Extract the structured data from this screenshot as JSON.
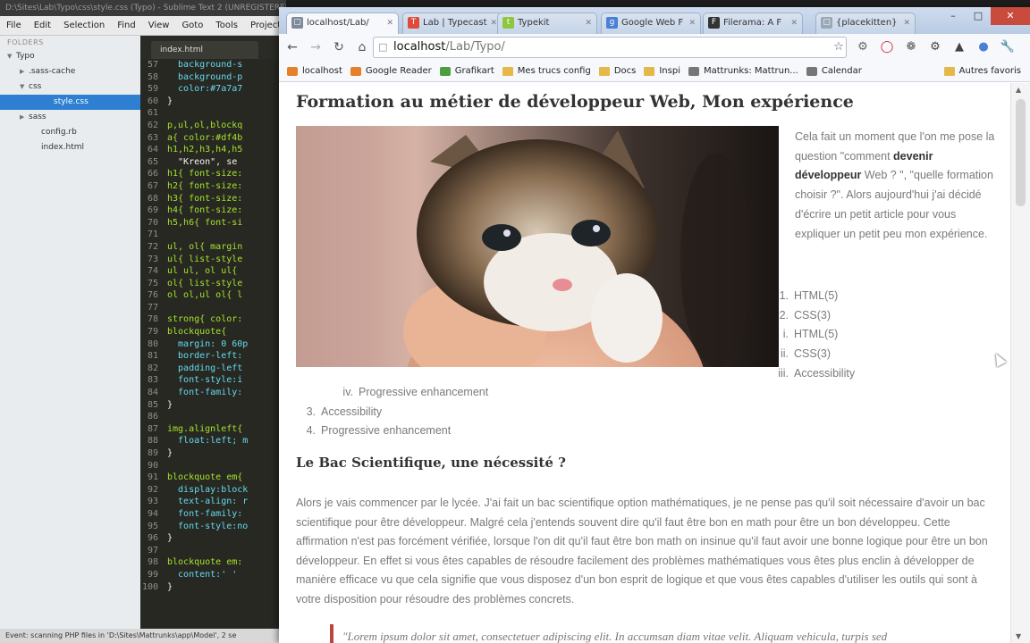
{
  "sublime": {
    "title": "D:\\Sites\\Lab\\Typo\\css\\style.css (Typo) - Sublime Text 2 (UNREGISTERED)",
    "menu": [
      "File",
      "Edit",
      "Selection",
      "Find",
      "View",
      "Goto",
      "Tools",
      "Project"
    ],
    "sidebar_header": "FOLDERS",
    "tree": [
      {
        "label": "Typo",
        "arrow": "▼",
        "indent": 8,
        "active": false
      },
      {
        "label": ".sass-cache",
        "arrow": "▶",
        "indent": 22,
        "active": false
      },
      {
        "label": "css",
        "arrow": "▼",
        "indent": 22,
        "active": false
      },
      {
        "label": "style.css",
        "arrow": "",
        "indent": 50,
        "active": true
      },
      {
        "label": "sass",
        "arrow": "▶",
        "indent": 22,
        "active": false
      },
      {
        "label": "config.rb",
        "arrow": "",
        "indent": 36,
        "active": false
      },
      {
        "label": "index.html",
        "arrow": "",
        "indent": 36,
        "active": false
      }
    ],
    "open_tab": "index.html",
    "code_lines": [
      {
        "n": "57",
        "t": "  background-s",
        "c": "pr"
      },
      {
        "n": "58",
        "t": "  background-p",
        "c": "pr"
      },
      {
        "n": "59",
        "t": "  color:#7a7a7",
        "c": "pr"
      },
      {
        "n": "60",
        "t": "}",
        "c": ""
      },
      {
        "n": "61",
        "t": "",
        "c": ""
      },
      {
        "n": "62",
        "t": "p,ul,ol,blockq",
        "c": "kw"
      },
      {
        "n": "63",
        "t": "a{ color:#df4b",
        "c": "kw"
      },
      {
        "n": "64",
        "t": "h1,h2,h3,h4,h5",
        "c": "kw"
      },
      {
        "n": "65",
        "t": "  \"Kreon\", se",
        "c": ""
      },
      {
        "n": "66",
        "t": "h1{ font-size:",
        "c": "kw"
      },
      {
        "n": "67",
        "t": "h2{ font-size:",
        "c": "kw"
      },
      {
        "n": "68",
        "t": "h3{ font-size:",
        "c": "kw"
      },
      {
        "n": "69",
        "t": "h4{ font-size:",
        "c": "kw"
      },
      {
        "n": "70",
        "t": "h5,h6{ font-si",
        "c": "kw"
      },
      {
        "n": "71",
        "t": "",
        "c": ""
      },
      {
        "n": "72",
        "t": "ul, ol{ margin",
        "c": "kw"
      },
      {
        "n": "73",
        "t": "ul{ list-style",
        "c": "kw"
      },
      {
        "n": "74",
        "t": "ul ul, ol ul{ ",
        "c": "kw"
      },
      {
        "n": "75",
        "t": "ol{ list-style",
        "c": "kw"
      },
      {
        "n": "76",
        "t": "ol ol,ul ol{ l",
        "c": "kw"
      },
      {
        "n": "77",
        "t": "",
        "c": ""
      },
      {
        "n": "78",
        "t": "strong{ color:",
        "c": "kw"
      },
      {
        "n": "79",
        "t": "blockquote{",
        "c": "kw"
      },
      {
        "n": "80",
        "t": "  margin: 0 60p",
        "c": "pr"
      },
      {
        "n": "81",
        "t": "  border-left:",
        "c": "pr"
      },
      {
        "n": "82",
        "t": "  padding-left",
        "c": "pr"
      },
      {
        "n": "83",
        "t": "  font-style:i",
        "c": "pr"
      },
      {
        "n": "84",
        "t": "  font-family:",
        "c": "pr"
      },
      {
        "n": "85",
        "t": "}",
        "c": ""
      },
      {
        "n": "86",
        "t": "",
        "c": ""
      },
      {
        "n": "87",
        "t": "img.alignleft{",
        "c": "kw"
      },
      {
        "n": "88",
        "t": "  float:left; m",
        "c": "pr"
      },
      {
        "n": "89",
        "t": "}",
        "c": ""
      },
      {
        "n": "90",
        "t": "",
        "c": ""
      },
      {
        "n": "91",
        "t": "blockquote em{",
        "c": "kw"
      },
      {
        "n": "92",
        "t": "  display:block",
        "c": "pr"
      },
      {
        "n": "93",
        "t": "  text-align: r",
        "c": "pr"
      },
      {
        "n": "94",
        "t": "  font-family:",
        "c": "pr"
      },
      {
        "n": "95",
        "t": "  font-style:no",
        "c": "pr"
      },
      {
        "n": "96",
        "t": "}",
        "c": ""
      },
      {
        "n": "97",
        "t": "",
        "c": ""
      },
      {
        "n": "98",
        "t": "blockquote em:",
        "c": "kw"
      },
      {
        "n": "99",
        "t": "  content:' '",
        "c": "pr"
      },
      {
        "n": "100",
        "t": "}",
        "c": ""
      }
    ],
    "status": "Event: scanning PHP files in 'D:\\Sites\\Mattrunks\\app\\Model', 2 se"
  },
  "chrome": {
    "tabs": [
      {
        "label": "localhost/Lab/",
        "fav_color": "#7d8a9c",
        "fav": "▢"
      },
      {
        "label": "Lab | Typecast",
        "fav_color": "#e04a3a",
        "fav": "T"
      },
      {
        "label": "Typekit",
        "fav_color": "#8ec63f",
        "fav": "t"
      },
      {
        "label": "Google Web F",
        "fav_color": "#4a7fd6",
        "fav": "g"
      },
      {
        "label": "Filerama: A F",
        "fav_color": "#333333",
        "fav": "F"
      },
      {
        "label": "{placekitten}",
        "fav_color": "#9aa7b5",
        "fav": "▢"
      }
    ],
    "url_host": "localhost",
    "url_path": "/Lab/Typo/",
    "bookmarks": [
      {
        "label": "localhost",
        "icon": "page"
      },
      {
        "label": "Google Reader",
        "icon": "page"
      },
      {
        "label": "Grafikart",
        "icon": "green"
      },
      {
        "label": "Mes trucs config",
        "icon": "folder"
      },
      {
        "label": "Docs",
        "icon": "folder"
      },
      {
        "label": "Inspi",
        "icon": "folder"
      },
      {
        "label": "Mattrunks: Mattrun...",
        "icon": "grey"
      },
      {
        "label": "Calendar",
        "icon": "grey"
      }
    ],
    "other_bookmarks": "Autres favoris"
  },
  "article": {
    "title": "Formation au métier de développeur Web, Mon expérience",
    "intro_before": "Cela fait un moment que l'on me pose la question \"comment ",
    "intro_bold": "devenir développeur",
    "intro_after": " Web ? \", \"quelle formation choisir ?\". Alors aujourd'hui j'ai décidé d'écrire un petit article pour vous expliquer un petit peu mon expérience.",
    "list_right": [
      {
        "num": "1.",
        "label": "HTML(5)"
      },
      {
        "num": "2.",
        "label": "CSS(3)"
      },
      {
        "num": "i.",
        "label": "HTML(5)"
      },
      {
        "num": "ii.",
        "label": "CSS(3)"
      },
      {
        "num": "iii.",
        "label": "Accessibility"
      }
    ],
    "list_left": [
      {
        "num": "iv.",
        "label": "Progressive enhancement"
      },
      {
        "num": "3.",
        "label": "Accessibility"
      },
      {
        "num": "4.",
        "label": "Progressive enhancement"
      }
    ],
    "section_title": "Le Bac Scientifique, une nécessité ?",
    "paragraph": "Alors je vais commencer par le lycée. J'ai fait un bac scientifique option mathématiques, je ne pense pas qu'il soit nécessaire d'avoir un bac scientifique pour être développeur. Malgré cela j'entends souvent dire qu'il faut être bon en math pour être un bon développeu. Cette affirmation n'est pas forcément vérifiée, lorsque l'on dit qu'il faut être bon math on insinue qu'il faut avoir une bonne logique pour être un bon développeur. En effet si vous êtes capables de résoudre facilement des problèmes mathématiques vous êtes plus enclin à développer de manière efficace vu que cela signifie que vous disposez d'un bon esprit de logique et que vous êtes capables d'utiliser les outils qui sont à votre disposition pour résoudre des problèmes concrets.",
    "quote": "\"Lorem ipsum dolor sit amet, consectetuer adipiscing elit. In accumsan diam vitae velit. Aliquam vehicula, turpis sed"
  },
  "colors": {
    "accent": "#b9473e",
    "link": "#df4b3e",
    "text_muted": "#7a7a7a",
    "heading": "#333333"
  }
}
